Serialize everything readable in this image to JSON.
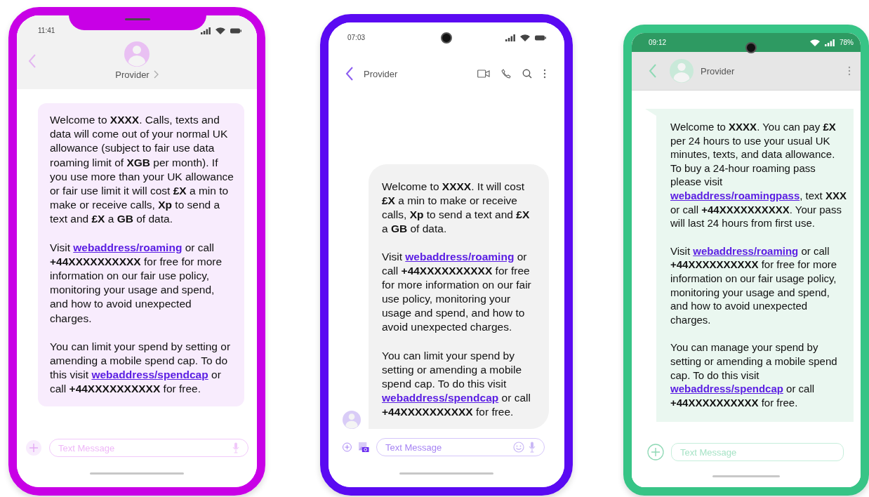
{
  "phones": [
    {
      "kind": "iphone",
      "time": "11:41",
      "contact": "Provider",
      "placeholder": "Text Message",
      "paragraphs": [
        [
          {
            "kind": "text",
            "text": "Welcome to **XXXX**. Calls, texts and data will come out of your normal UK allowance (subject to fair use data roaming limit of **XGB** per month).  If you use more than your UK allowance or fair use limit it will cost **£X** a min to make or receive calls, **Xp** to send a text and **£X** a **GB** of data."
          }
        ],
        [
          {
            "kind": "text",
            "text": "Visit "
          },
          {
            "kind": "link",
            "text": "webaddress/roaming"
          },
          {
            "kind": "text",
            "text": " or call **+44XXXXXXXXXX** for free for more information on our fair use policy, monitoring your usage and spend, and how to avoid unexpected charges."
          }
        ],
        [
          {
            "kind": "text",
            "text": "You can limit your spend by setting or amending a mobile spend cap. To do this visit "
          },
          {
            "kind": "link",
            "text": "webaddress/spendcap"
          },
          {
            "kind": "text",
            "text": " or call **+44XXXXXXXXXX** for free."
          }
        ]
      ]
    },
    {
      "kind": "pixel",
      "time": "07:03",
      "contact": "Provider",
      "placeholder": "Text Message",
      "paragraphs": [
        [
          {
            "kind": "text",
            "text": "Welcome to **XXXX**. It will cost **£X** a min to make or receive calls, **Xp** to send a text and **£X** a **GB** of data."
          }
        ],
        [
          {
            "kind": "text",
            "text": "Visit "
          },
          {
            "kind": "link",
            "text": "webaddress/roaming"
          },
          {
            "kind": "text",
            "text": " or call **+44XXXXXXXXXX** for free for more information on our fair use policy, monitoring your usage and spend, and how to avoid unexpected charges."
          }
        ],
        [
          {
            "kind": "text",
            "text": "You can limit your spend by setting or amending a mobile spend cap. To do this visit "
          },
          {
            "kind": "link",
            "text": "webaddress/spendcap"
          },
          {
            "kind": "text",
            "text": " or call **+44XXXXXXXXXX** for free."
          }
        ]
      ]
    },
    {
      "kind": "samsung",
      "time": "09:12",
      "battery": "78%",
      "contact": "Provider",
      "placeholder": "Text Message",
      "paragraphs": [
        [
          {
            "kind": "text",
            "text": "Welcome to **XXXX**. You can pay **£X** per 24 hours to use your usual UK minutes, texts, and data allowance. To buy a 24-hour roaming pass please visit "
          },
          {
            "kind": "link",
            "text": "webaddress/roamingpass"
          },
          {
            "kind": "text",
            "text": ", text **XXX** or call **+44XXXXXXXXXX**. Your pass will last 24 hours from first use."
          }
        ],
        [
          {
            "kind": "text",
            "text": "Visit "
          },
          {
            "kind": "link",
            "text": "webaddress/roaming"
          },
          {
            "kind": "text",
            "text": " or call **+44XXXXXXXXXX** for free for more information on our fair usage policy, monitoring your usage and spend, and how to avoid unexpected charges."
          }
        ],
        [
          {
            "kind": "text",
            "text": "You can manage your spend by setting or amending a mobile spend cap. To do this visit "
          },
          {
            "kind": "link",
            "text": "webaddress/spendcap"
          },
          {
            "kind": "text",
            "text": " or call **+44XXXXXXXXXX** for free."
          }
        ]
      ]
    }
  ]
}
